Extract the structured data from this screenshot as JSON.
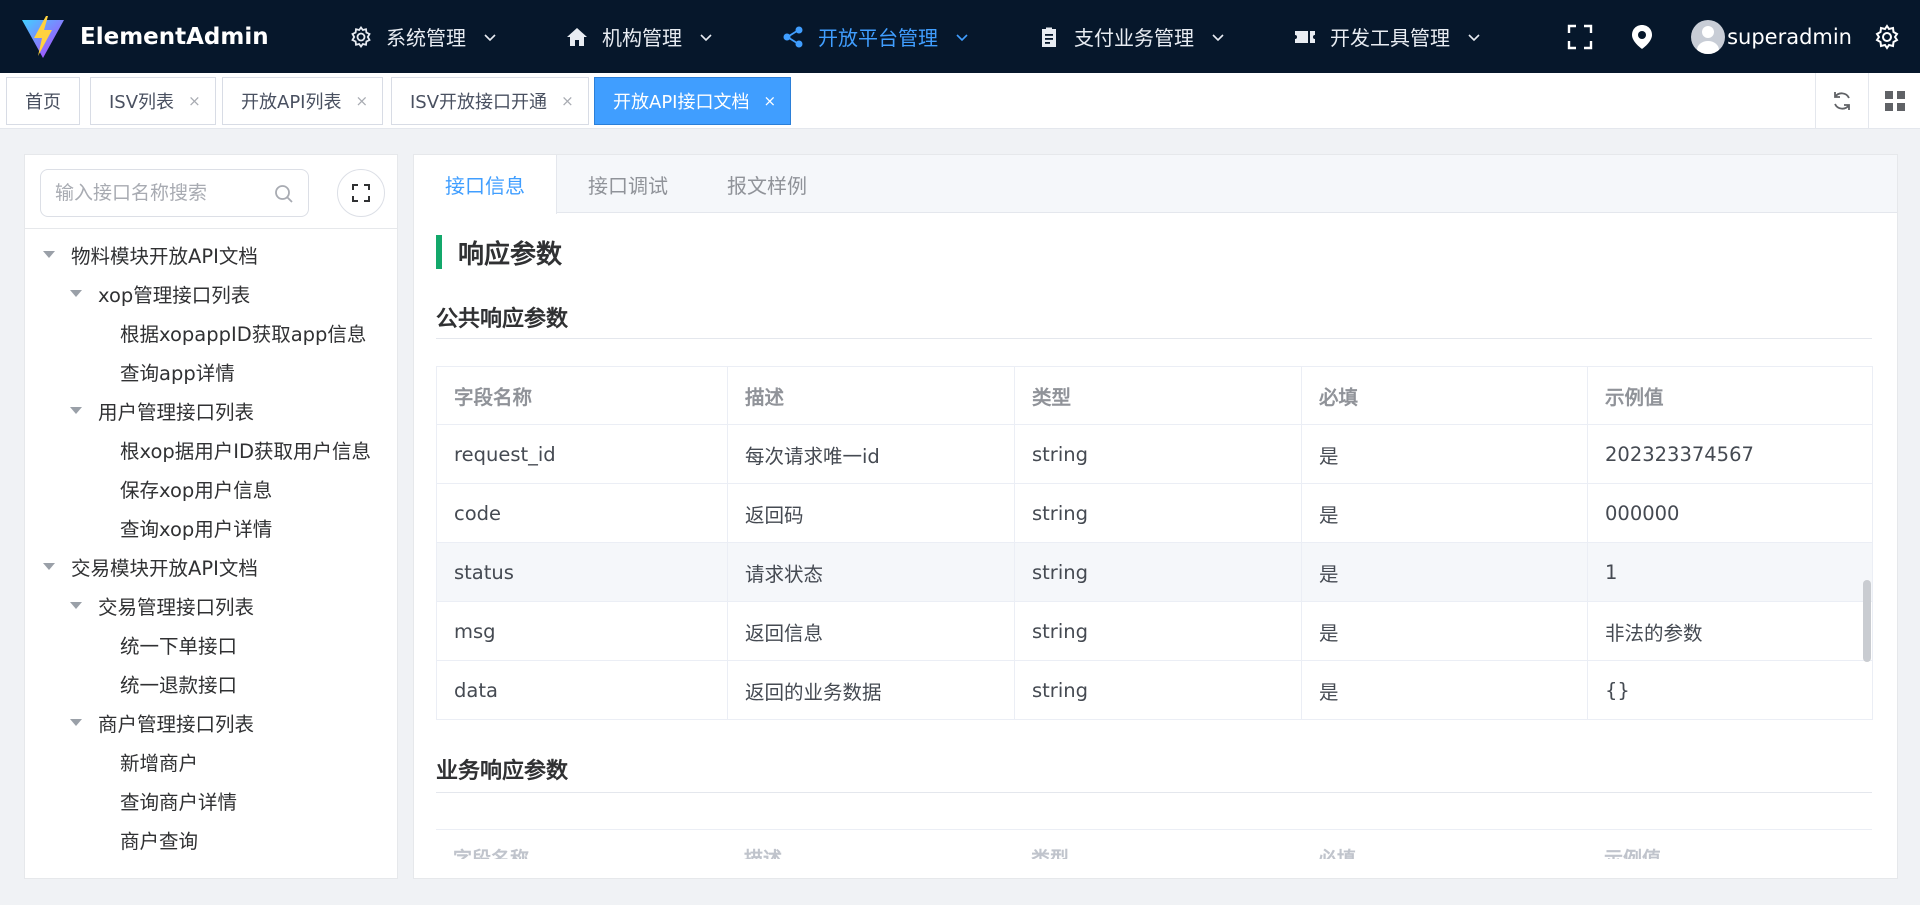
{
  "app": {
    "name": "ElementAdmin"
  },
  "nav": {
    "menus": [
      {
        "label": "系统管理",
        "icon": "gear-icon"
      },
      {
        "label": "机构管理",
        "icon": "home-icon"
      },
      {
        "label": "开放平台管理",
        "icon": "share-icon",
        "active": true
      },
      {
        "label": "支付业务管理",
        "icon": "clipboard-icon"
      },
      {
        "label": "开发工具管理",
        "icon": "ticket-icon"
      }
    ],
    "user": "superadmin"
  },
  "tabs": [
    {
      "label": "首页",
      "closable": false
    },
    {
      "label": "ISV列表",
      "closable": true
    },
    {
      "label": "开放API列表",
      "closable": true
    },
    {
      "label": "ISV开放接口开通",
      "closable": true
    },
    {
      "label": "开放API接口文档",
      "closable": true,
      "active": true
    }
  ],
  "tab_close_glyph": "×",
  "sidebar": {
    "search_placeholder": "输入接口名称搜索",
    "tree": [
      {
        "label": "物料模块开放API文档",
        "level": 0
      },
      {
        "label": "xop管理接口列表",
        "level": 1
      },
      {
        "label": "根据xopappID获取app信息",
        "level": 2
      },
      {
        "label": "查询app详情",
        "level": 2
      },
      {
        "label": "用户管理接口列表",
        "level": 1
      },
      {
        "label": "根xop据用户ID获取用户信息",
        "level": 2
      },
      {
        "label": "保存xop用户信息",
        "level": 2
      },
      {
        "label": "查询xop用户详情",
        "level": 2
      },
      {
        "label": "交易模块开放API文档",
        "level": 0
      },
      {
        "label": "交易管理接口列表",
        "level": 1
      },
      {
        "label": "统一下单接口",
        "level": 2
      },
      {
        "label": "统一退款接口",
        "level": 2
      },
      {
        "label": "商户管理接口列表",
        "level": 1
      },
      {
        "label": "新增商户",
        "level": 2
      },
      {
        "label": "查询商户详情",
        "level": 2
      },
      {
        "label": "商户查询",
        "level": 2
      }
    ]
  },
  "main": {
    "tabs": [
      "接口信息",
      "接口调试",
      "报文样例"
    ],
    "section_title": "响应参数",
    "public_title": "公共响应参数",
    "business_title": "业务响应参数",
    "columns": [
      "字段名称",
      "描述",
      "类型",
      "必填",
      "示例值"
    ],
    "rows": [
      [
        "request_id",
        "每次请求唯一id",
        "string",
        "是",
        "202323374567"
      ],
      [
        "code",
        "返回码",
        "string",
        "是",
        "000000"
      ],
      [
        "status",
        "请求状态",
        "string",
        "是",
        "1"
      ],
      [
        "msg",
        "返回信息",
        "string",
        "是",
        "非法的参数"
      ],
      [
        "data",
        "返回的业务数据",
        "string",
        "是",
        "{}"
      ]
    ],
    "highlighted_row": 2
  },
  "colors": {
    "nav_bg": "#06172b",
    "accent": "#409eff",
    "section_bar": "#13a86b"
  }
}
